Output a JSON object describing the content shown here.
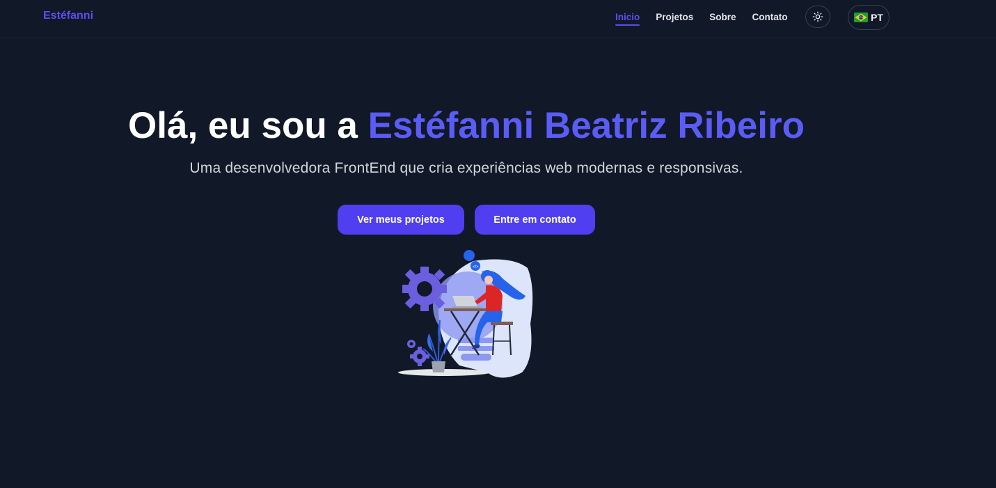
{
  "brand": "Estéfanni",
  "nav": {
    "items": [
      {
        "label": "Inicio",
        "active": true
      },
      {
        "label": "Projetos",
        "active": false
      },
      {
        "label": "Sobre",
        "active": false
      },
      {
        "label": "Contato",
        "active": false
      }
    ],
    "theme_icon": "sun-icon",
    "language": {
      "flag": "brazil-flag-icon",
      "label": "PT"
    }
  },
  "hero": {
    "title_prefix": "Olá, eu sou a ",
    "title_name": "Estéfanni Beatriz Ribeiro",
    "subtitle": "Uma desenvolvedora FrontEnd que cria experiências web modernas e responsivas.",
    "primary_button": "Ver meus projetos",
    "secondary_button": "Entre em contato",
    "illustration": "developer-woman-illustration"
  },
  "colors": {
    "background": "#111827",
    "accent": "#5b5cf6",
    "button": "#4f3ff0"
  }
}
